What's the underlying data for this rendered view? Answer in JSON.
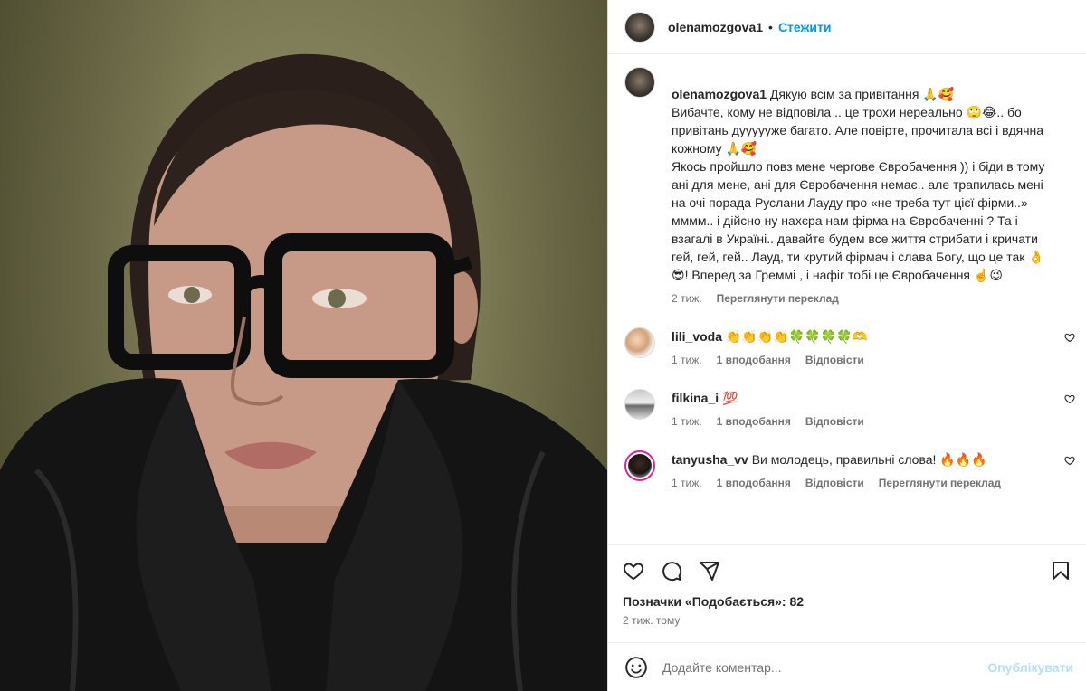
{
  "header": {
    "username": "olenamozgova1",
    "separator": "•",
    "follow_label": "Стежити"
  },
  "caption": {
    "username": "olenamozgova1",
    "text": " Дякую всім за привітання 🙏🥰\nВибачте, кому не відповіла .. це трохи нереально 🙄😂.. бо привітань дуууууже багато. Але повірте, прочитала всі і вдячна кожному 🙏🥰\nЯкось пройшло повз мене чергове Євробачення )) і біди в тому ані для мене, ані для Євробачення немає.. але трапилась мені на очі порада Руслани Лауду про «не треба тут цієї фірми..» мммм.. і дійсно ну нахєра нам фірма на Євробаченні ? Та і взагалі в Україні.. давайте будем все життя стрибати і кричати гей, гей, гей.. Лауд, ти крутий фірмач і слава Богу, що це так 👌😎! Вперед за Греммі , і нафіг тобі це Євробачення ☝️😉",
    "time": "2 тиж.",
    "translate_label": "Переглянути переклад"
  },
  "comments": [
    {
      "username": "lili_voda",
      "text": " 👏👏👏👏🍀🍀🍀🍀🫶",
      "time": "1 тиж.",
      "likes": "1 вподобання",
      "reply_label": "Відповісти",
      "translate_label": ""
    },
    {
      "username": "filkina_i",
      "text": " 💯",
      "time": "1 тиж.",
      "likes": "1 вподобання",
      "reply_label": "Відповісти",
      "translate_label": ""
    },
    {
      "username": "tanyusha_vv",
      "text": " Ви молодець, правильні слова! 🔥🔥🔥",
      "time": "1 тиж.",
      "likes": "1 вподобання",
      "reply_label": "Відповісти",
      "translate_label": "Переглянути переклад"
    }
  ],
  "likes_text": "Позначки «Подобається»: 82",
  "posted_time": "2 тиж. тому",
  "add_comment": {
    "placeholder": "Додайте коментар...",
    "publish_label": "Опублікувати"
  },
  "icons": {
    "like": "heart-icon",
    "comment": "comment-icon",
    "share": "share-icon",
    "save": "bookmark-icon",
    "emoji": "emoji-icon"
  }
}
